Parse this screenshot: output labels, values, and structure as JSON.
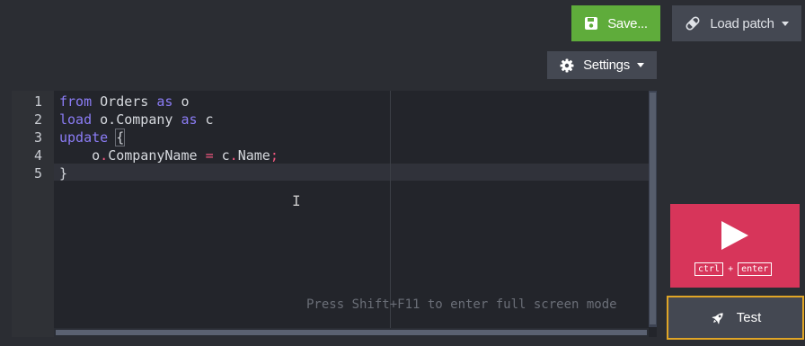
{
  "toolbar": {
    "save_label": "Save...",
    "load_patch_label": "Load patch",
    "settings_label": "Settings"
  },
  "editor": {
    "line_numbers": [
      "1",
      "2",
      "3",
      "4",
      "5"
    ],
    "lines": [
      {
        "t1": "from",
        "t2": " Orders ",
        "t3": "as",
        "t4": " o"
      },
      {
        "t1": "load",
        "t2": " o.Company ",
        "t3": "as",
        "t4": " c"
      },
      {
        "t1": "update",
        "t2": " ",
        "t3": "{"
      },
      {
        "t1": "    o",
        "t2": ".",
        "t3": "CompanyName ",
        "t4": "=",
        "t5": " c",
        "t6": ".",
        "t7": "Name",
        "t8": ";"
      },
      {
        "t1": "}"
      }
    ],
    "hint": "Press Shift+F11 to enter full screen mode"
  },
  "run": {
    "key1": "ctrl",
    "plus": "+",
    "key2": "enter"
  },
  "test": {
    "label": "Test"
  },
  "colors": {
    "save": "#5fac3b",
    "run": "#d7355a",
    "test_border": "#e0a526",
    "keyword": "#8b7cf5",
    "operator": "#f0577f"
  },
  "icons": [
    "floppy-disk-icon",
    "bandage-icon",
    "gear-icon",
    "chevron-down-icon",
    "play-icon",
    "rocket-icon",
    "text-cursor-icon"
  ]
}
